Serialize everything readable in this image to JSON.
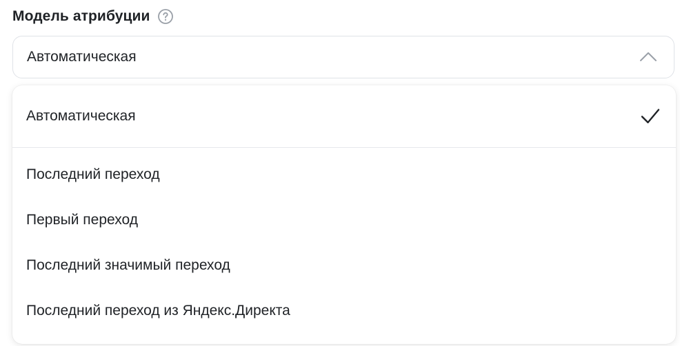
{
  "field": {
    "label": "Модель атрибуции",
    "help_icon": "question-circle-icon",
    "selected_value": "Автоматическая",
    "chevron_icon": "chevron-up-icon"
  },
  "dropdown": {
    "selected_option": {
      "label": "Автоматическая",
      "check_icon": "checkmark-icon"
    },
    "options": [
      {
        "label": "Последний переход"
      },
      {
        "label": "Первый переход"
      },
      {
        "label": "Последний значимый переход"
      },
      {
        "label": "Последний переход из Яндекс.Директа"
      }
    ]
  },
  "colors": {
    "text": "#1f2226",
    "border": "#dfe2e7",
    "icon_muted": "#9aa0a8"
  }
}
